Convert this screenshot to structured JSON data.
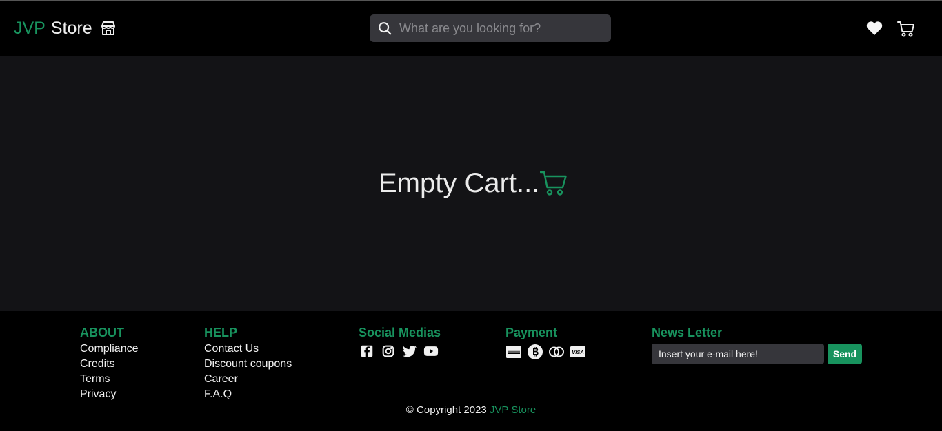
{
  "header": {
    "brand_accent": "JVP",
    "brand_plain": "Store",
    "search_placeholder": "What are you looking for?"
  },
  "main": {
    "empty_text": "Empty Cart..."
  },
  "footer": {
    "about": {
      "title": "ABOUT",
      "links": [
        "Compliance",
        "Credits",
        "Terms",
        "Privacy"
      ]
    },
    "help": {
      "title": "HELP",
      "links": [
        "Contact Us",
        "Discount coupons",
        "Career",
        "F.A.Q"
      ]
    },
    "social": {
      "title": "Social Medias",
      "icons": [
        "facebook-icon",
        "instagram-icon",
        "twitter-icon",
        "youtube-icon"
      ]
    },
    "payment": {
      "title": "Payment",
      "icons": [
        "amex-icon",
        "bitcoin-icon",
        "mastercard-icon",
        "visa-icon"
      ]
    },
    "newsletter": {
      "title": "News Letter",
      "placeholder": "Insert your e-mail here!",
      "button": "Send"
    },
    "copyright_prefix": "© Copyright 2023",
    "copyright_brand": "JVP Store"
  },
  "colors": {
    "accent": "#18935e",
    "background": "#131316",
    "bar": "#000000",
    "input": "#36363b"
  }
}
